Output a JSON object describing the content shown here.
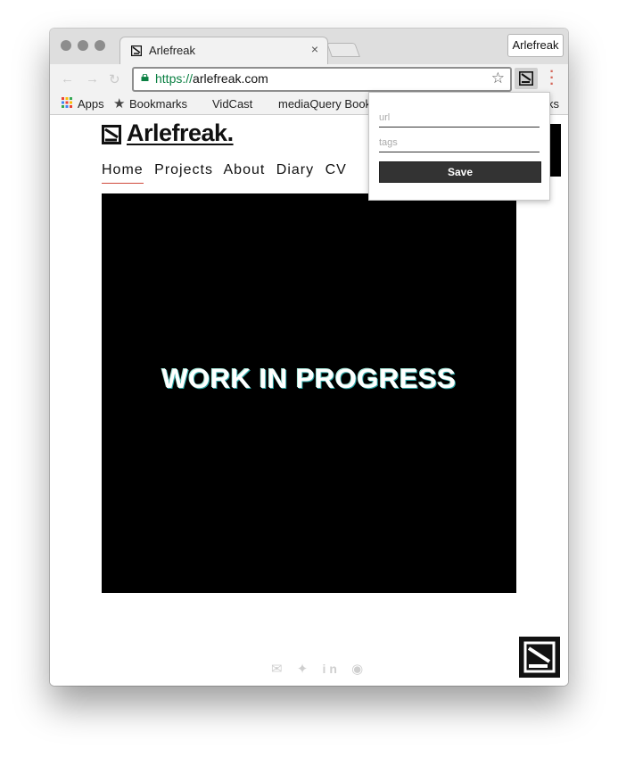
{
  "browser": {
    "tab_title": "Arlefreak",
    "tab_close": "×",
    "profile_label": "Arlefreak",
    "url_scheme": "https://",
    "url_host": "arlefreak.com"
  },
  "bookmarks": [
    {
      "label": "Apps",
      "icon": "apps-icon"
    },
    {
      "label": "Bookmarks",
      "icon": "star-icon"
    },
    {
      "label": "VidCast",
      "icon": ""
    },
    {
      "label": "mediaQuery Book",
      "icon": ""
    },
    {
      "label": "ks",
      "icon": ""
    }
  ],
  "site": {
    "logo_text": "Arlefreak.",
    "nav": [
      "Home",
      "Projects",
      "About",
      "Diary",
      "CV"
    ],
    "hero_text": "WORK IN PROGRESS",
    "social_icons": [
      "mail-icon",
      "twitter-icon",
      "linkedin-icon",
      "github-icon"
    ]
  },
  "popup": {
    "url_placeholder": "url",
    "tags_placeholder": "tags",
    "save_label": "Save"
  },
  "colors": {
    "nav_active_underline": "#d04a3c",
    "secure_scheme": "#0b8043",
    "kebab": "#d5675a"
  }
}
